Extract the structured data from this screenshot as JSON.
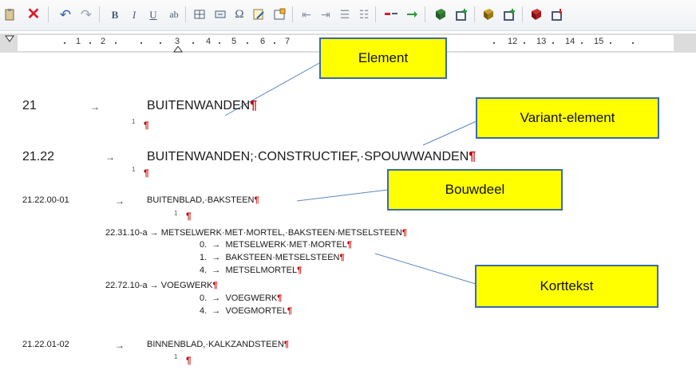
{
  "toolbar": {
    "italic_label": "I",
    "bold_label": "B",
    "underline_label": "U",
    "strike_label": "ab",
    "omega_label": "Ω"
  },
  "ruler": {
    "labels": [
      "1",
      "2",
      "3",
      "4",
      "5",
      "6",
      "7",
      "12",
      "13",
      "14",
      "15"
    ]
  },
  "document": {
    "h1_number": "21",
    "h1_text": "BUITENWANDEN",
    "h2_number": "21.22",
    "h2_text": "BUITENWANDEN;·CONSTRUCTIEF,·SPOUWWANDEN",
    "b1_number": "21.22.00-01",
    "b1_text": "BUITENBLAD,·BAKSTEEN",
    "k1_code": "22.31.10-a",
    "k1_text": "METSELWERK·MET·MORTEL,·BAKSTEEN·METSELSTEEN",
    "k1_sub": [
      {
        "num": "0.",
        "text": "METSELWERK·MET·MORTEL"
      },
      {
        "num": "1.",
        "text": "BAKSTEEN·METSELSTEEN"
      },
      {
        "num": "4.",
        "text": "METSELMORTEL"
      }
    ],
    "k2_code": "22.72.10-a",
    "k2_text": "VOEGWERK",
    "k2_sub": [
      {
        "num": "0.",
        "text": "VOEGWERK"
      },
      {
        "num": "4.",
        "text": "VOEGMORTEL"
      }
    ],
    "b2_number": "21.22.01-02",
    "b2_text": "BINNENBLAD,·KALKZANDSTEEN",
    "arrow": "→",
    "pilcrow": "¶",
    "level_mark": "1"
  },
  "callouts": {
    "element": "Element",
    "variant": "Variant-element",
    "bouwdeel": "Bouwdeel",
    "korttekst": "Korttekst"
  },
  "colors": {
    "callout_fill": "#ffff00",
    "callout_border": "#3a6aa8",
    "pilcrow": "#c00000"
  }
}
